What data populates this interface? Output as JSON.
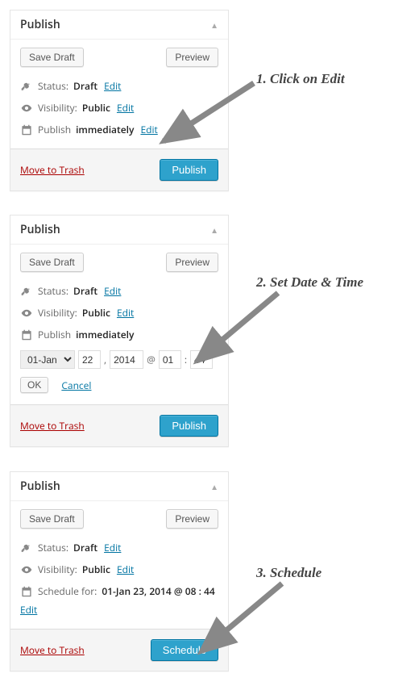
{
  "annotations": {
    "step1": "1. Click on Edit",
    "step2": "2. Set Date & Time",
    "step3": "3. Schedule"
  },
  "panel1": {
    "title": "Publish",
    "saveDraft": "Save Draft",
    "preview": "Preview",
    "statusLabel": "Status:",
    "statusValue": "Draft",
    "statusEdit": "Edit",
    "visibilityLabel": "Visibility:",
    "visibilityValue": "Public",
    "visibilityEdit": "Edit",
    "publishLabel": "Publish",
    "publishValue": "immediately",
    "publishEdit": "Edit",
    "trash": "Move to Trash",
    "submit": "Publish"
  },
  "panel2": {
    "title": "Publish",
    "saveDraft": "Save Draft",
    "preview": "Preview",
    "statusLabel": "Status:",
    "statusValue": "Draft",
    "statusEdit": "Edit",
    "visibilityLabel": "Visibility:",
    "visibilityValue": "Public",
    "visibilityEdit": "Edit",
    "publishLabel": "Publish",
    "publishValue": "immediately",
    "month": "01-Jan",
    "day": "22",
    "year": "2014",
    "hour": "01",
    "min": "44",
    "ok": "OK",
    "cancel": "Cancel",
    "trash": "Move to Trash",
    "submit": "Publish"
  },
  "panel3": {
    "title": "Publish",
    "saveDraft": "Save Draft",
    "preview": "Preview",
    "statusLabel": "Status:",
    "statusValue": "Draft",
    "statusEdit": "Edit",
    "visibilityLabel": "Visibility:",
    "visibilityValue": "Public",
    "visibilityEdit": "Edit",
    "scheduleLabel": "Schedule for:",
    "scheduleValue": "01-Jan 23, 2014 @ 08 : 44",
    "scheduleEdit": "Edit",
    "trash": "Move to Trash",
    "submit": "Schedule"
  }
}
